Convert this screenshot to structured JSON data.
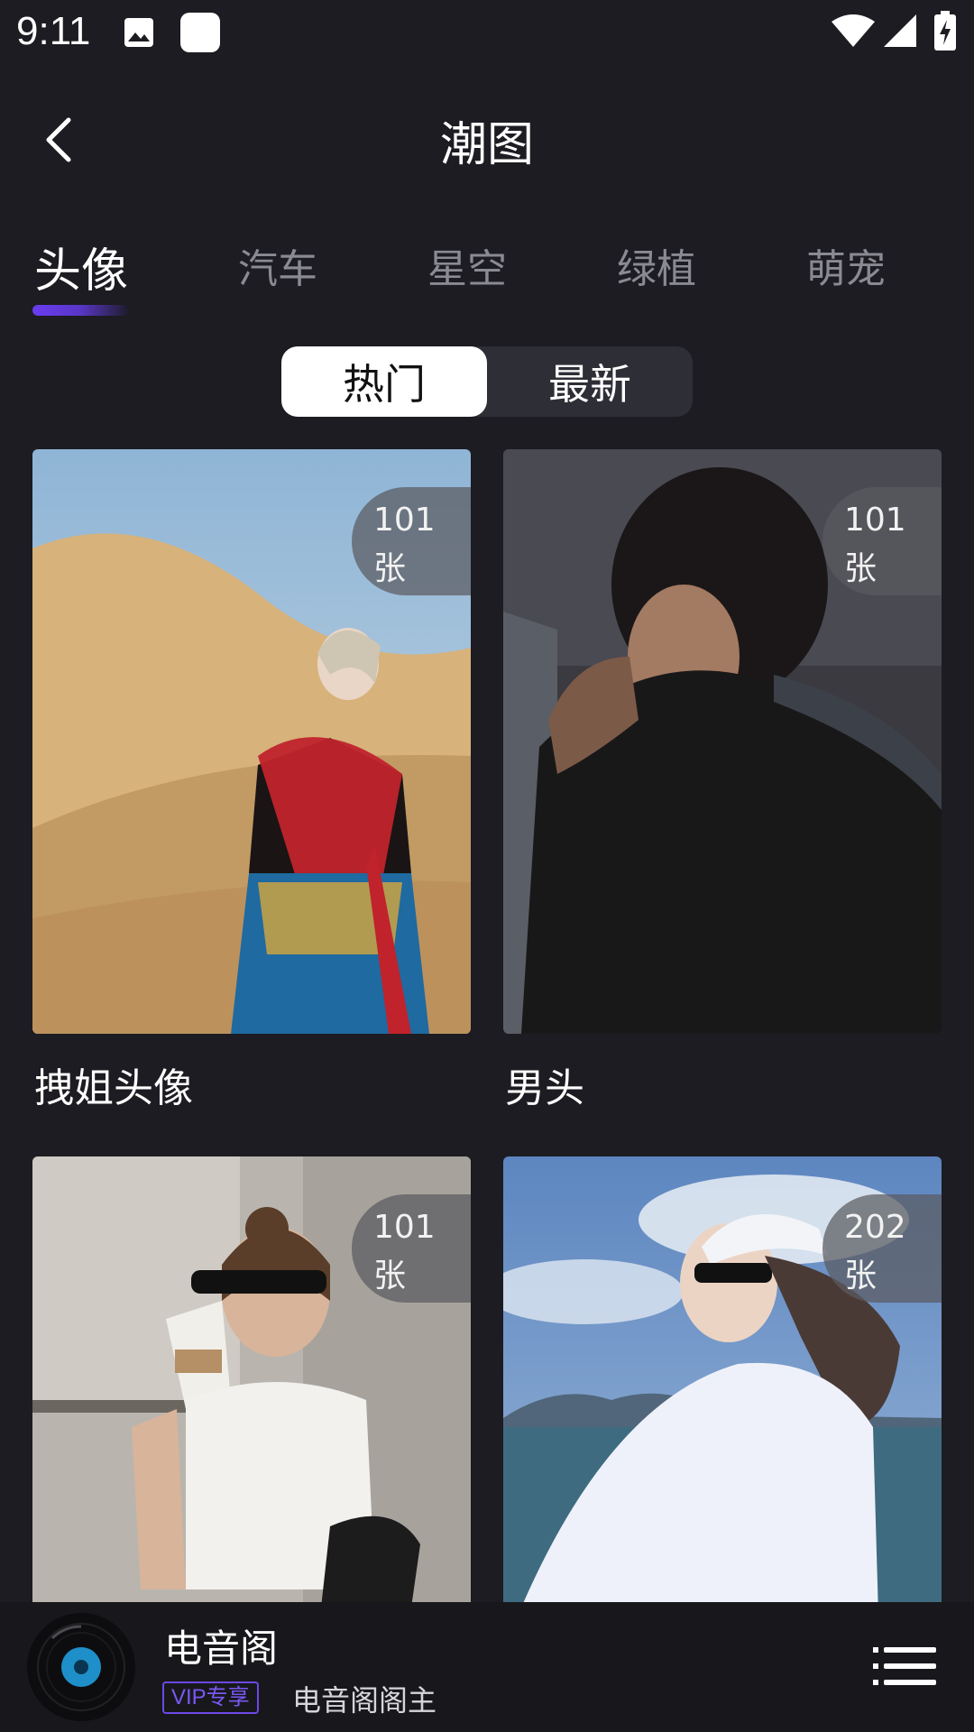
{
  "status_bar": {
    "time": "9:11"
  },
  "header": {
    "title": "潮图"
  },
  "tabs": [
    {
      "label": "头像",
      "active": true
    },
    {
      "label": "汽车",
      "active": false
    },
    {
      "label": "星空",
      "active": false
    },
    {
      "label": "绿植",
      "active": false
    },
    {
      "label": "萌宠",
      "active": false
    }
  ],
  "segment": {
    "hot": "热门",
    "latest": "最新",
    "selected": "热门"
  },
  "cards": [
    {
      "title": "拽姐头像",
      "count": "101",
      "unit": "张"
    },
    {
      "title": "男头",
      "count": "101",
      "unit": "张"
    },
    {
      "title": "",
      "count": "101",
      "unit": "张"
    },
    {
      "title": "",
      "count": "202",
      "unit": "张"
    }
  ],
  "player": {
    "name": "电音阁",
    "vip": "VIP专享",
    "artist": "电音阁阁主"
  },
  "colors": {
    "background": "#1c1c22",
    "accent": "#6a3cf0",
    "tab_inactive": "#8a8a92"
  }
}
